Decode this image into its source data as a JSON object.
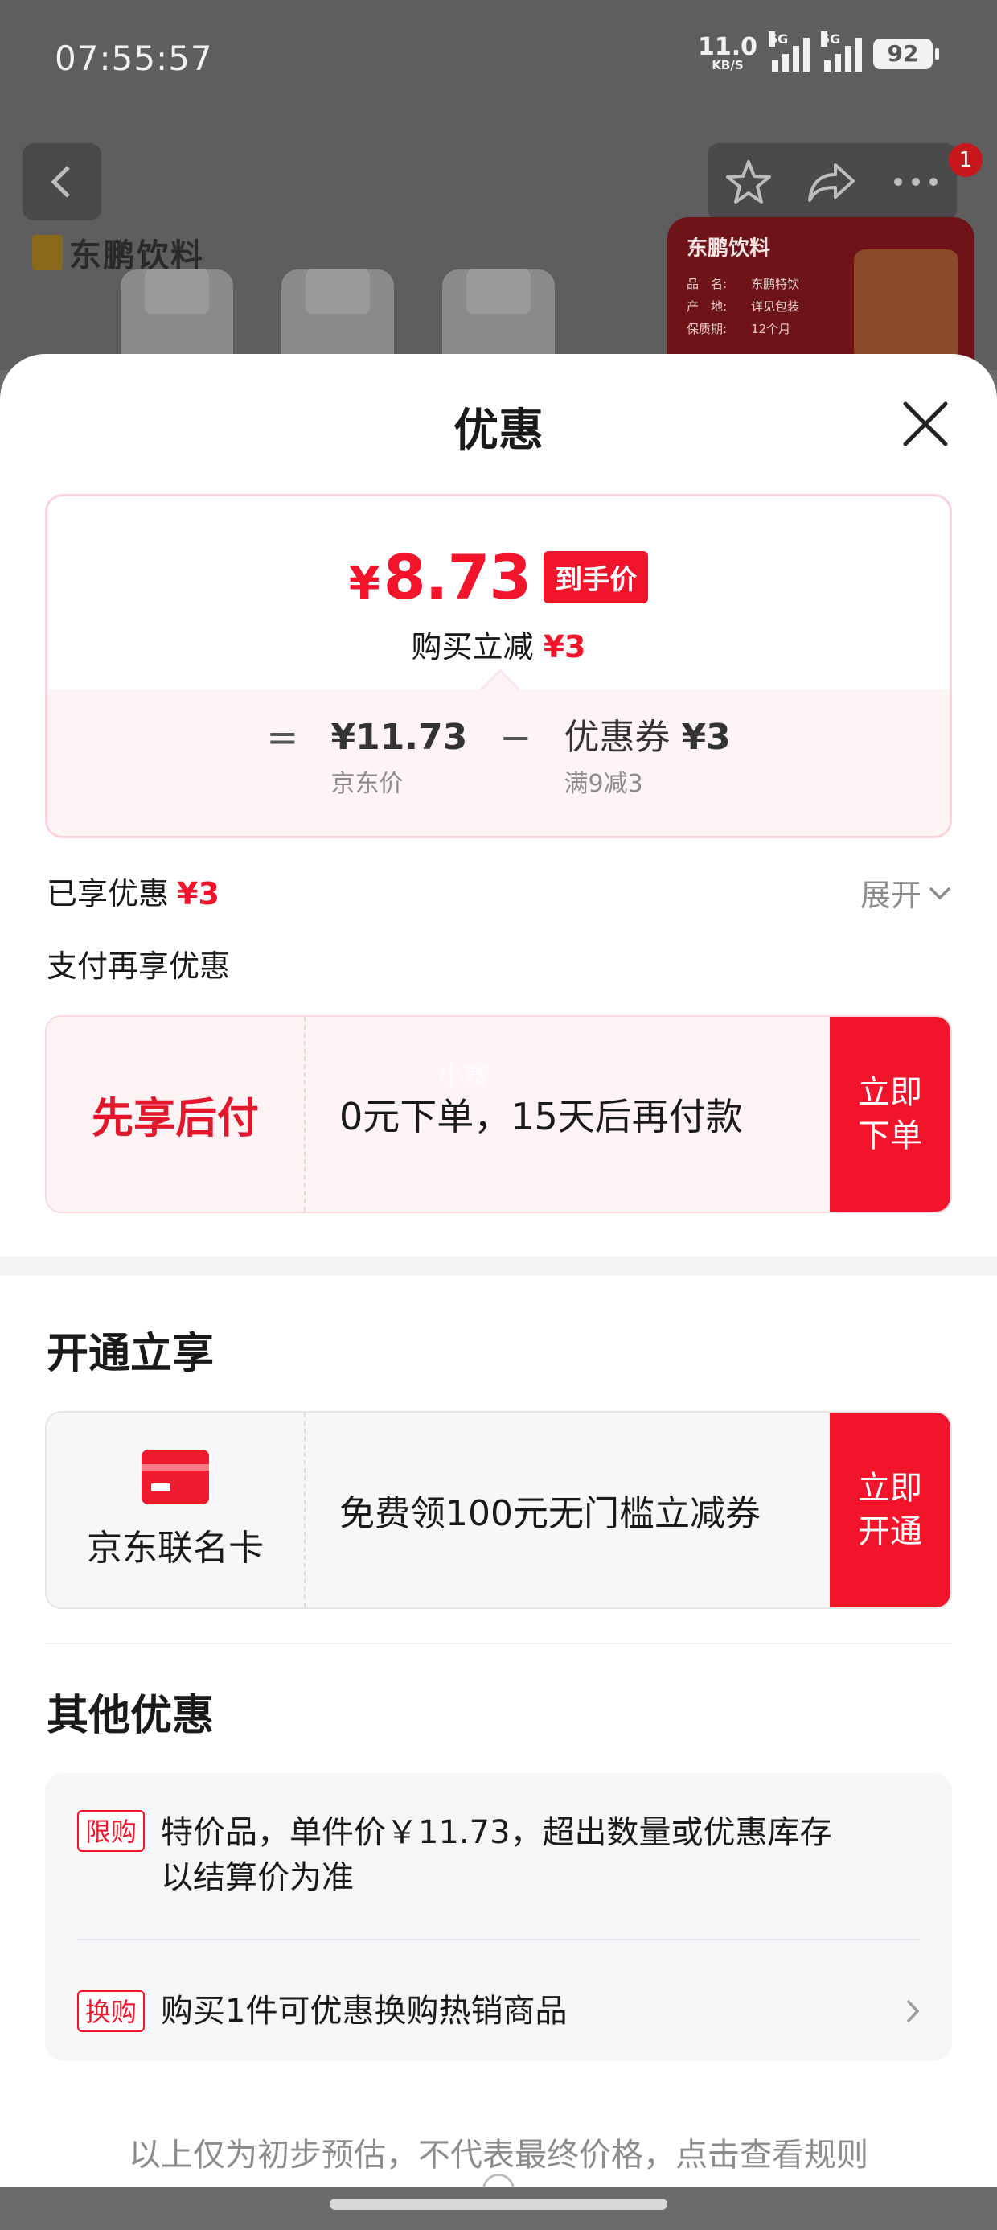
{
  "status_bar": {
    "time": "07:55:57",
    "net_speed": "11.0",
    "net_unit": "KB/S",
    "signal1_label": "5G",
    "signal2_label": "5G",
    "battery": "92"
  },
  "background_page": {
    "brand": "东鹏饮料",
    "nav_badge": "1",
    "promo_title": "东鹏饮料",
    "promo_rows": [
      {
        "k": "品　名:",
        "v": "东鹏特饮"
      },
      {
        "k": "产　地:",
        "v": "详见包装"
      },
      {
        "k": "保质期:",
        "v": "12个月"
      }
    ]
  },
  "sheet": {
    "title": "优惠",
    "price": {
      "symbol": "¥",
      "value": "8.73",
      "tag": "到手价",
      "sub_text": "购买立减",
      "sub_amount": "¥3"
    },
    "breakdown": {
      "eq": "=",
      "jd_price": "¥11.73",
      "jd_label": "京东价",
      "minus": "−",
      "coupon_prefix": "优惠券",
      "coupon_amount": "¥3",
      "coupon_label": "满9减3"
    },
    "enjoyed_label": "已享优惠",
    "enjoyed_amount": "¥3",
    "expand_label": "展开",
    "pay_more_label": "支付再享优惠",
    "bnpl": {
      "title": "先享后付",
      "desc": "0元下单，15天后再付款",
      "button_line1": "立即",
      "button_line2": "下单",
      "watermark": "小赛"
    },
    "open_section_title": "开通立享",
    "card": {
      "name": "京东联名卡",
      "desc": "免费领100元无门槛立减券",
      "button_line1": "立即",
      "button_line2": "开通"
    },
    "other_section_title": "其他优惠",
    "other": [
      {
        "tag": "限购",
        "text_line1": "特价品，单件价￥11.73，超出数量或优惠库存",
        "text_line2": "以结算价为准"
      },
      {
        "tag": "换购",
        "text": "购买1件可优惠换购热销商品"
      }
    ],
    "footer_note": "以上仅为初步预估，不代表最终价格，点击查看规则"
  },
  "colors": {
    "accent_red": "#f2142b",
    "overlay": "#5e5e5e"
  }
}
